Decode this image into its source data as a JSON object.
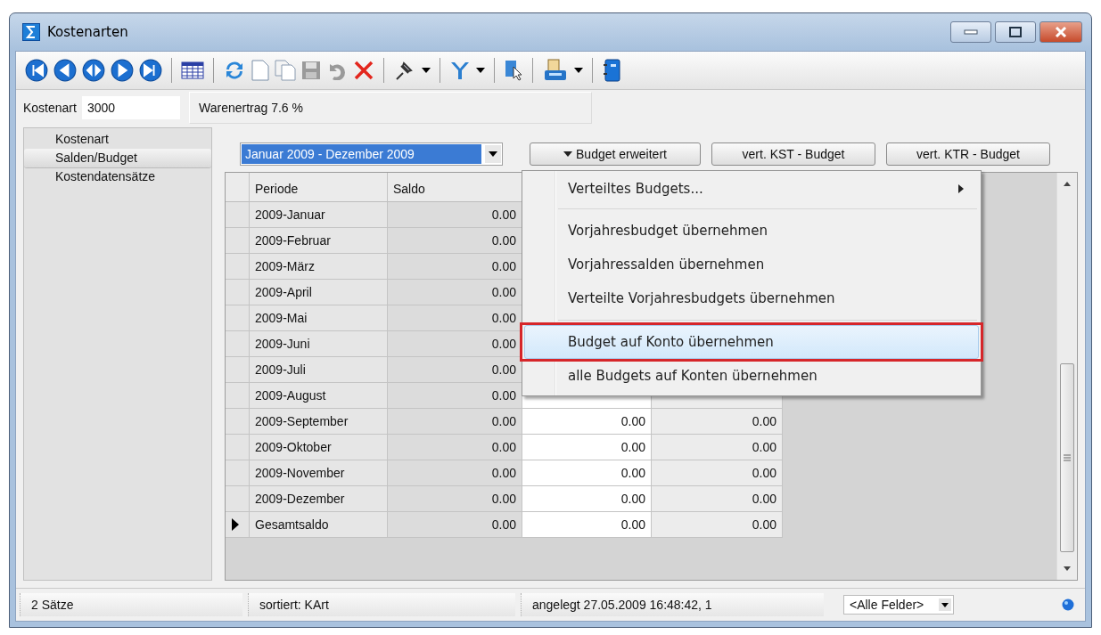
{
  "window": {
    "title": "Kostenarten"
  },
  "record": {
    "label": "Kostenart",
    "value": "3000",
    "description": "Warenertrag 7.6 %"
  },
  "sidebar": {
    "items": [
      {
        "label": "Kostenart",
        "selected": false
      },
      {
        "label": "Salden/Budget",
        "selected": true
      },
      {
        "label": "Kostendatensätze",
        "selected": false
      }
    ]
  },
  "period_select": {
    "value": "Januar 2009 - Dezember 2009"
  },
  "buttons": [
    {
      "label": "Budget erweitert",
      "kind": "menu"
    },
    {
      "label": "vert. KST - Budget",
      "kind": "plain"
    },
    {
      "label": "vert. KTR - Budget",
      "kind": "plain"
    }
  ],
  "table": {
    "columns": [
      "Periode",
      "Saldo"
    ],
    "rows": [
      {
        "period": "2009-Januar",
        "saldo": "0.00",
        "current": false
      },
      {
        "period": "2009-Februar",
        "saldo": "0.00",
        "current": false
      },
      {
        "period": "2009-März",
        "saldo": "0.00",
        "current": false
      },
      {
        "period": "2009-April",
        "saldo": "0.00",
        "current": false
      },
      {
        "period": "2009-Mai",
        "saldo": "0.00",
        "current": false
      },
      {
        "period": "2009-Juni",
        "saldo": "0.00",
        "current": false
      },
      {
        "period": "2009-Juli",
        "saldo": "0.00",
        "current": false
      },
      {
        "period": "2009-August",
        "saldo": "0.00",
        "current": false
      },
      {
        "period": "2009-September",
        "saldo": "0.00",
        "column_3": "0.00",
        "column_4": "0.00",
        "current": false
      },
      {
        "period": "2009-Oktober",
        "saldo": "0.00",
        "column_3": "0.00",
        "column_4": "0.00",
        "current": false
      },
      {
        "period": "2009-November",
        "saldo": "0.00",
        "column_3": "0.00",
        "column_4": "0.00",
        "current": false
      },
      {
        "period": "2009-Dezember",
        "saldo": "0.00",
        "column_3": "0.00",
        "column_4": "0.00",
        "current": false
      },
      {
        "period": "Gesamtsaldo",
        "saldo": "0.00",
        "column_3": "0.00",
        "column_4": "0.00",
        "current": true
      }
    ]
  },
  "context_menu": {
    "groups": [
      [
        {
          "label": "Verteiltes Budgets...",
          "submenu": true,
          "selected": false
        }
      ],
      [
        {
          "label": "Vorjahresbudget übernehmen",
          "submenu": false,
          "selected": false
        },
        {
          "label": "Vorjahressalden übernehmen",
          "submenu": false,
          "selected": false
        },
        {
          "label": "Verteilte Vorjahresbudgets übernehmen",
          "submenu": false,
          "selected": false
        }
      ],
      [
        {
          "label": "Budget auf Konto übernehmen",
          "submenu": false,
          "selected": true,
          "outlined": true
        },
        {
          "label": "alle Budgets auf Konten übernehmen",
          "submenu": false,
          "selected": false,
          "outlined": false
        }
      ]
    ]
  },
  "status_bar": {
    "records": "2 Sätze",
    "sort": "sortiert: KArt",
    "created": "angelegt 27.05.2009 16:48:42,  1",
    "field_filter": "<Alle Felder>"
  }
}
